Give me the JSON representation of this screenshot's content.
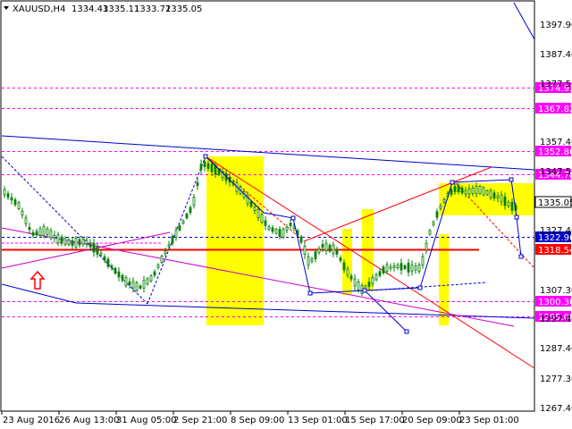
{
  "chart_data": {
    "type": "candlestick",
    "symbol_label": "XAUUSD,H4",
    "ohlc_values": [
      "1334.43",
      "1335.11",
      "1333.72",
      "1335.05"
    ],
    "ylim": [
      1262,
      1405
    ],
    "y_ticks": [
      "1397.90",
      "1387.40",
      "1377.50",
      "1357.40",
      "1347.50",
      "1327.40",
      "1307.30",
      "1297.40",
      "1287.40",
      "1277.30",
      "1267.40"
    ],
    "x_ticks": [
      "23 Aug 2016",
      "26 Aug 13:00",
      "31 Aug 05:00",
      "2 Sep 21:00",
      "8 Sep 09:00",
      "13 Sep 01:00",
      "15 Sep 17:00",
      "20 Sep 09:00",
      "23 Sep 01:00"
    ],
    "price_levels": [
      {
        "label": "1374.93",
        "value": 1374.93,
        "style": "dashed",
        "color": "#ff00ff"
      },
      {
        "label": "1367.82",
        "value": 1367.82,
        "style": "dashed",
        "color": "#ff00ff"
      },
      {
        "label": "1352.86",
        "value": 1352.86,
        "style": "dashed",
        "color": "#ff00ff"
      },
      {
        "label": "1344.78",
        "value": 1344.78,
        "style": "dashed",
        "color": "#ff00ff"
      },
      {
        "label": "1335.05",
        "value": 1335.05,
        "style": "current",
        "color": "#ffffff"
      },
      {
        "label": "1322.96",
        "value": 1322.96,
        "style": "dashed",
        "color": "#0000cc"
      },
      {
        "label": "1318.54",
        "value": 1318.54,
        "style": "solid",
        "color": "#ff0000"
      },
      {
        "label": "1300.30",
        "value": 1300.3,
        "style": "dashed",
        "color": "#ff00ff"
      },
      {
        "label": "1295.08",
        "value": 1295.08,
        "style": "dashed",
        "color": "#ff00ff"
      }
    ],
    "colors": {
      "candle": "#008000",
      "highlight": "#ffff00",
      "red_line": "#ff0000",
      "blue_line": "#0000cc",
      "magenta_line": "#cc00cc"
    }
  }
}
